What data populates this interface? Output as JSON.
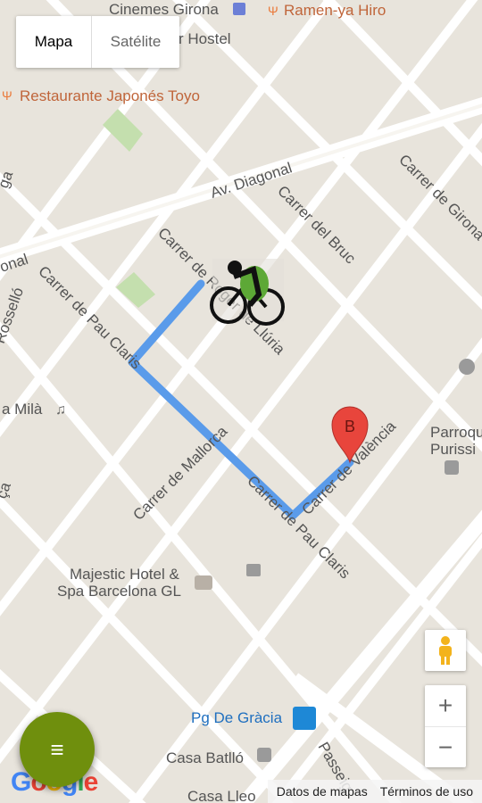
{
  "map": {
    "streets": {
      "diagonal": "Av. Diagonal",
      "girona": "Carrer de Girona",
      "bruc": "Carrer del Bruc",
      "lluria": "Carrer de Roger de Llúria",
      "pau_claris_top": "Carrer de Pau Claris",
      "pau_claris_bottom": "Carrer de Pau Claris",
      "mallorca": "Carrer de Mallorca",
      "valencia": "Carrer de València",
      "rossello": "Rosselló",
      "diagonal_left": "onal",
      "left_ca": "ça",
      "left_ga": "ga",
      "passeig": "Passeig"
    },
    "pois": {
      "cinemes": "Cinemes Girona",
      "ramen": "Ramen-ya Hiro",
      "hostel": "r Hostel",
      "restaurante": "Restaurante Japonés Toyo",
      "mila": "a Milà",
      "parroquia_1": "Parroqu",
      "parroquia_2": "Purissi",
      "majestic_1": "Majestic Hotel &",
      "majestic_2": "Spa Barcelona GL",
      "metro": "Pg De Gràcia",
      "batllo": "Casa Batlló",
      "lleo": "Casa Lleo"
    },
    "marker_label": "B",
    "route_color": "#5a9bea",
    "marker_color": "#e8453c"
  },
  "controls": {
    "map_type": {
      "map": "Mapa",
      "satellite": "Satélite"
    },
    "zoom_in": "+",
    "zoom_out": "−",
    "fab_icon": "≡"
  },
  "attribution": {
    "data": "Datos de mapas",
    "terms": "Términos de uso"
  },
  "logo": "Google"
}
